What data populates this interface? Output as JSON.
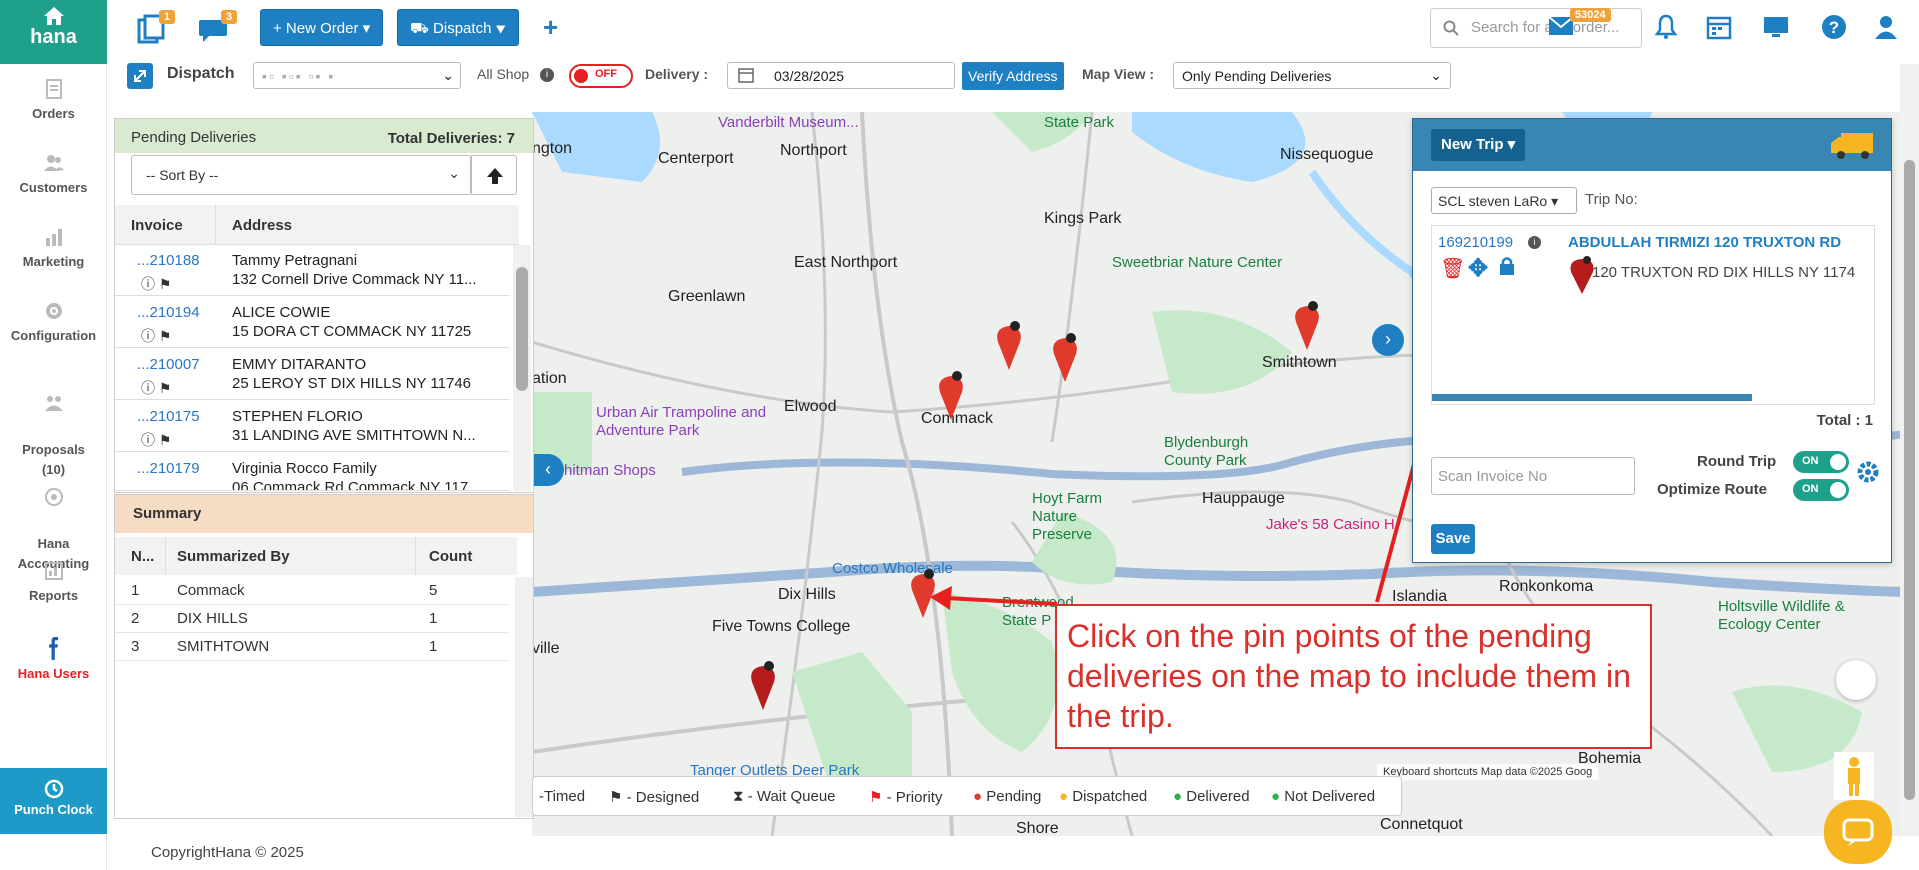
{
  "app": {
    "brand": "hana"
  },
  "sidebar": {
    "items": [
      {
        "label": "Orders"
      },
      {
        "label": "Customers"
      },
      {
        "label": "Marketing"
      },
      {
        "label": "Configuration"
      },
      {
        "label": "Proposals\n(10)"
      },
      {
        "label": "Hana\nAccounting"
      },
      {
        "label": "Reports"
      },
      {
        "label": "Hana Users"
      }
    ],
    "punch_clock": "Punch Clock"
  },
  "topbar": {
    "badge_orders": "1",
    "badge_messages": "3",
    "new_order": "+ New Order ▾",
    "dispatch": "Dispatch ▾",
    "search_placeholder": "Search for any order...",
    "mail_badge": "53024"
  },
  "toolbar": {
    "dispatch_label": "Dispatch",
    "all_shop": "All Shop",
    "off_toggle": "OFF",
    "delivery_label": "Delivery :",
    "delivery_date": "03/28/2025",
    "verify_address": "Verify Address",
    "map_view_label": "Map View :",
    "map_view_value": "Only Pending Deliveries"
  },
  "pending": {
    "title": "Pending Deliveries",
    "total": "Total Deliveries: 7",
    "sort_by": "-- Sort By --",
    "col_invoice": "Invoice",
    "col_address": "Address",
    "rows": [
      {
        "invoice": "...210188",
        "name": "Tammy Petragnani",
        "address": "132 Cornell Drive Commack NY 11..."
      },
      {
        "invoice": "...210194",
        "name": "ALICE COWIE",
        "address": "15 DORA CT COMMACK NY 11725"
      },
      {
        "invoice": "...210007",
        "name": "EMMY DITARANTO",
        "address": "25 LEROY ST DIX HILLS NY 11746"
      },
      {
        "invoice": "...210175",
        "name": "STEPHEN FLORIO",
        "address": "31 LANDING AVE SMITHTOWN N..."
      },
      {
        "invoice": "...210179",
        "name": "Virginia Rocco Family",
        "address": "06 Commack Rd Commack NY 117..."
      }
    ]
  },
  "summary": {
    "title": "Summary",
    "col_n": "N...",
    "col_by": "Summarized By",
    "col_count": "Count",
    "rows": [
      {
        "n": "1",
        "by": "Commack",
        "count": "5"
      },
      {
        "n": "2",
        "by": "DIX HILLS",
        "count": "1"
      },
      {
        "n": "3",
        "by": "SMITHTOWN",
        "count": "1"
      }
    ]
  },
  "map": {
    "labels": [
      "Vanderbilt Museum...",
      "State Park",
      "Nissequogue",
      "Centerport",
      "Northport",
      "Kings Park",
      "East Northport",
      "Greenlawn",
      "Sweetbriar Nature Center",
      "Smithtown",
      "Elwood",
      "Commack",
      "Urban Air Trampoline and Adventure Park",
      "Blydenburgh County Park",
      "Hoyt Farm Nature Preserve",
      "Hauppauge",
      "Jake's 58 Casino H",
      "Costco Wholesale",
      "Dix Hills",
      "Brentwood State P",
      "Islandia",
      "Ronkonkoma",
      "Five Towns College",
      "Holtsville Wildlife & Ecology Center",
      "Bohemia",
      "Tanger Outlets Deer Park",
      "Connetquot",
      "Shore",
      "hitman Shops",
      "ngton",
      "ation",
      "ville"
    ],
    "footer": "Keyboard shortcuts   Map data ©2025 Goog"
  },
  "legend": {
    "timed": "-Timed",
    "designed": "- Designed",
    "wait_queue": "- Wait Queue",
    "priority": "- Priority",
    "pending": "Pending",
    "dispatched": "Dispatched",
    "delivered": "Delivered",
    "not_delivered": "Not Delivered"
  },
  "trip": {
    "new_trip": "New Trip ▾",
    "driver": "SCL steven LaRo ▾",
    "trip_no": "Trip No:",
    "invoice": "169210199",
    "name": "ABDULLAH TIRMIZI 120 TRUXTON RD",
    "address": "120 TRUXTON RD DIX HILLS NY 1174",
    "total": "Total : 1",
    "scan_placeholder": "Scan Invoice No",
    "round_trip": "Round Trip",
    "optimize_route": "Optimize Route",
    "on": "ON",
    "save": "Save"
  },
  "annotation": "Click on the pin points of the pending deliveries on the map to include them in the trip.",
  "footer": "CopyrightHana © 2025",
  "colors": {
    "brand": "#1fa08a",
    "primary": "#1f7fc3",
    "pin": "#e03a2c",
    "annotation": "#d9302c"
  }
}
